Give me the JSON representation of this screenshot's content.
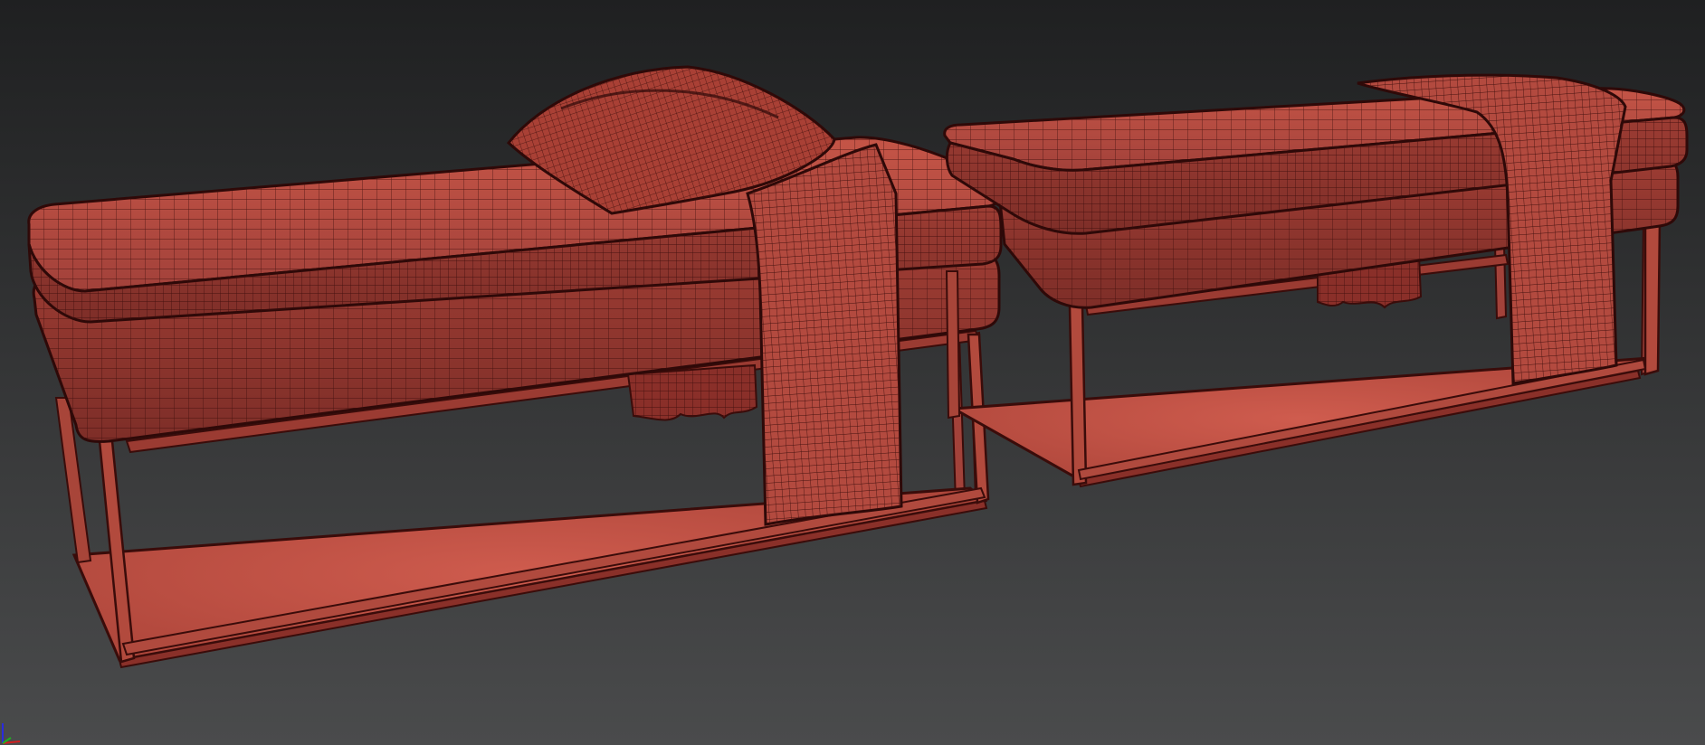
{
  "viewport": {
    "background_top": "#1f2021",
    "background_bottom": "#4a4b4c",
    "shading_mode": "edged-faces"
  },
  "scene": {
    "objects": [
      {
        "name": "bench-left",
        "color": "#b44a3e",
        "wire_color": "#3a0c0a",
        "floor_color": "#c4564a"
      },
      {
        "name": "bench-right",
        "color": "#b44a3e",
        "wire_color": "#3a0c0a",
        "floor_color": "#c4564a"
      },
      {
        "name": "pillow",
        "color": "#a94035"
      },
      {
        "name": "throw-blanket-left",
        "color": "#b34a3f"
      },
      {
        "name": "throw-blanket-right",
        "color": "#b34a3f"
      }
    ]
  },
  "axis_gizmo": {
    "x_color": "#d02020",
    "y_color": "#20b020",
    "z_color": "#2a2adf"
  }
}
